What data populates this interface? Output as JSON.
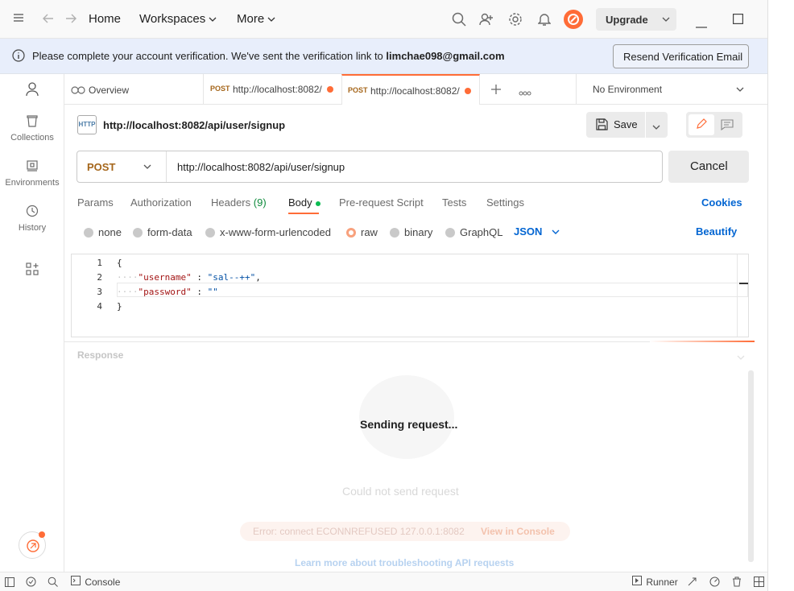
{
  "titlebar": {
    "home": "Home",
    "workspaces": "Workspaces",
    "more": "More",
    "upgrade": "Upgrade",
    "icons": [
      "hamburger-icon",
      "back-arrow-icon",
      "forward-arrow-icon",
      "search-icon",
      "invite-user-icon",
      "settings-icon",
      "bell-icon",
      "postman-logo"
    ]
  },
  "banner": {
    "message": "Please complete your account verification. We've sent the verification link to",
    "email": "limchae098@gmail.com",
    "button": "Resend Verification Email"
  },
  "sidebar": {
    "items": [
      {
        "label": "Collections",
        "icon": "collections-icon"
      },
      {
        "label": "Environments",
        "icon": "environments-icon"
      },
      {
        "label": "History",
        "icon": "history-icon"
      }
    ]
  },
  "tabs": {
    "overview": "Overview",
    "items": [
      {
        "method": "POST",
        "url": "http://localhost:8082/",
        "unsaved": true
      },
      {
        "method": "POST",
        "url": "http://localhost:8082/",
        "unsaved": true,
        "active": true
      }
    ],
    "environment": "No Environment"
  },
  "request": {
    "badge": "HTTP",
    "title": "http://localhost:8082/api/user/signup",
    "save": "Save",
    "method": "POST",
    "url": "http://localhost:8082/api/user/signup",
    "send_state": "Cancel"
  },
  "subtabs": {
    "params": "Params",
    "authorization": "Authorization",
    "headers": "Headers",
    "headers_count": "(9)",
    "body": "Body",
    "prerequest": "Pre-request Script",
    "tests": "Tests",
    "settings": "Settings",
    "cookies": "Cookies"
  },
  "body_types": {
    "none": "none",
    "form_data": "form-data",
    "urlencoded": "x-www-form-urlencoded",
    "raw": "raw",
    "binary": "binary",
    "graphql": "GraphQL",
    "selected": "raw",
    "format": "JSON",
    "beautify": "Beautify"
  },
  "editor": {
    "lines": [
      {
        "num": "1",
        "text": "{"
      },
      {
        "num": "2",
        "key": "\"username\"",
        "sep": " : ",
        "value": "\"sal--++\"",
        "end": ","
      },
      {
        "num": "3",
        "key": "\"password\"",
        "sep": " : ",
        "value": "\"\"",
        "end": ""
      },
      {
        "num": "4",
        "text": "}"
      }
    ]
  },
  "response": {
    "label": "Response",
    "status": "Sending request...",
    "ghost_title": "Could not send request",
    "ghost_error": "Error: connect ECONNREFUSED 127.0.0.1:8082",
    "ghost_link": "View in Console",
    "learn_more": "Learn more about troubleshooting API requests"
  },
  "statusbar": {
    "console": "Console",
    "runner": "Runner"
  },
  "colors": {
    "accent": "#ff6c37",
    "link": "#0265d2",
    "method_post": "#a5661b"
  }
}
